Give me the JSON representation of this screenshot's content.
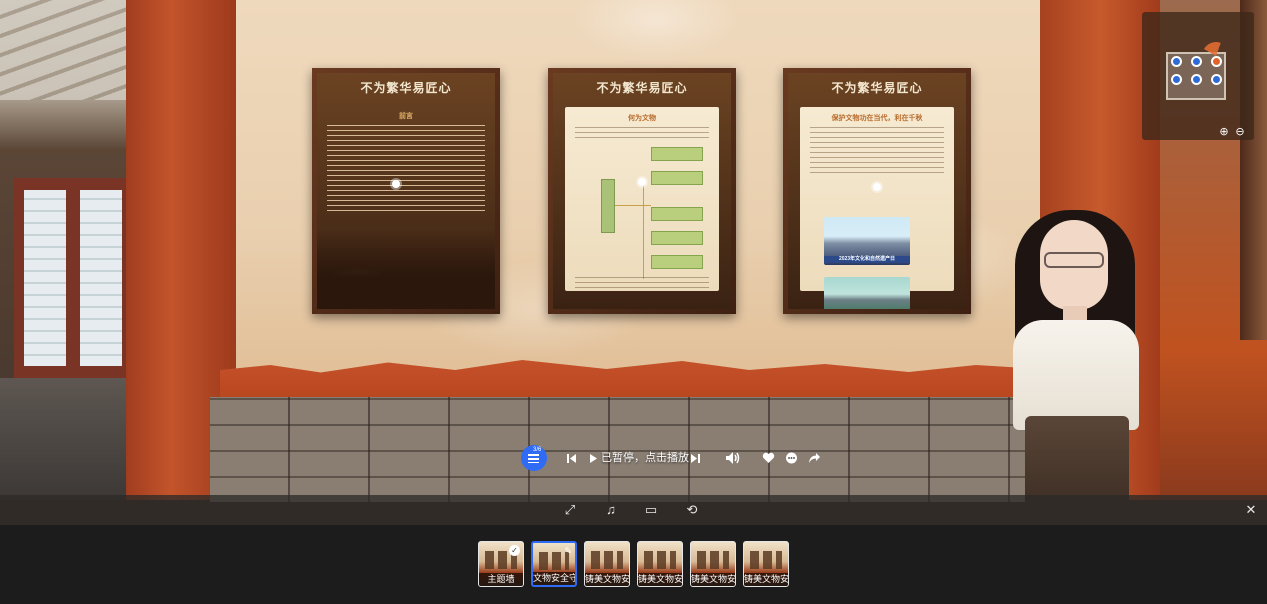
{
  "posters": [
    {
      "title": "不为繁华易匠心",
      "subtitle": "",
      "heading": "前言"
    },
    {
      "title": "不为繁华易匠心",
      "subtitle": "",
      "heading": "何为文物"
    },
    {
      "title": "不为繁华易匠心",
      "subtitle": "",
      "heading": "保护文物功在当代，利在千秋",
      "photo_caption": "2023年文化和自然遗产日"
    }
  ],
  "player": {
    "playlist_count": "3/6",
    "status": "已暂停，点击播放",
    "icons": {
      "playlist": "playlist-icon",
      "prev": "skip-previous-icon",
      "play": "play-icon",
      "next": "skip-next-icon",
      "volume": "volume-icon",
      "like": "heart-icon",
      "comment": "comment-icon",
      "share": "share-icon"
    }
  },
  "minimap": {
    "zoom_in": "⊕",
    "zoom_out": "⊖"
  },
  "toolbar": {
    "fullscreen": "⤢",
    "music": "♫",
    "vr": "▭",
    "gyro": "⟲",
    "close": "✕"
  },
  "thumbnails": [
    {
      "label": "主题墙",
      "state": "visited"
    },
    {
      "label": "文物安全守护",
      "state": "active"
    },
    {
      "label": "铸美文物安全",
      "state": "normal"
    },
    {
      "label": "铸美文物安全",
      "state": "normal"
    },
    {
      "label": "铸美文物安全",
      "state": "normal"
    },
    {
      "label": "铸美文物安全",
      "state": "normal"
    }
  ]
}
